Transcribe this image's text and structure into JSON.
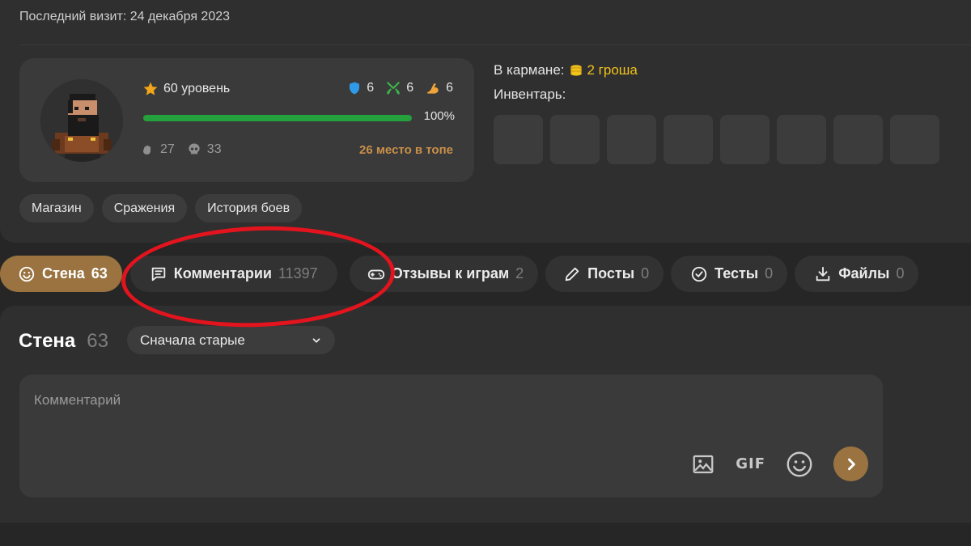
{
  "profile": {
    "last_visit": "Последний визит: 24 декабря 2023",
    "level": "60 уровень",
    "stat_shield": "6",
    "stat_swords": "6",
    "stat_strength": "6",
    "progress_label": "100%",
    "progress_fraction": 1.0,
    "kills": "27",
    "deaths": "33",
    "rank": "26 место в топе"
  },
  "pocket": {
    "label": "В кармане:",
    "coins": "2 гроша",
    "inventory_label": "Инвентарь:",
    "inventory_slots": 8
  },
  "links": [
    "Магазин",
    "Сражения",
    "История боев"
  ],
  "tabs": [
    {
      "label": "Стена",
      "count": "63",
      "icon": "smile-icon"
    },
    {
      "label": "Комментарии",
      "count": "11397",
      "icon": "comment-icon"
    },
    {
      "label": "Отзывы к играм",
      "count": "2",
      "icon": "gamepad-icon"
    },
    {
      "label": "Посты",
      "count": "0",
      "icon": "pencil-icon"
    },
    {
      "label": "Тесты",
      "count": "0",
      "icon": "check-circle-icon"
    },
    {
      "label": "Файлы",
      "count": "0",
      "icon": "download-icon"
    }
  ],
  "wall": {
    "title": "Стена",
    "count": "63",
    "sort_value": "Сначала старые",
    "comment_placeholder": "Комментарий",
    "gif_label": "GIF"
  },
  "colors": {
    "accent": "#9a7341",
    "progress": "#24a13d",
    "coins": "#f1c21b",
    "rank": "#c98f4a",
    "highlight_circle": "#e3141d"
  }
}
